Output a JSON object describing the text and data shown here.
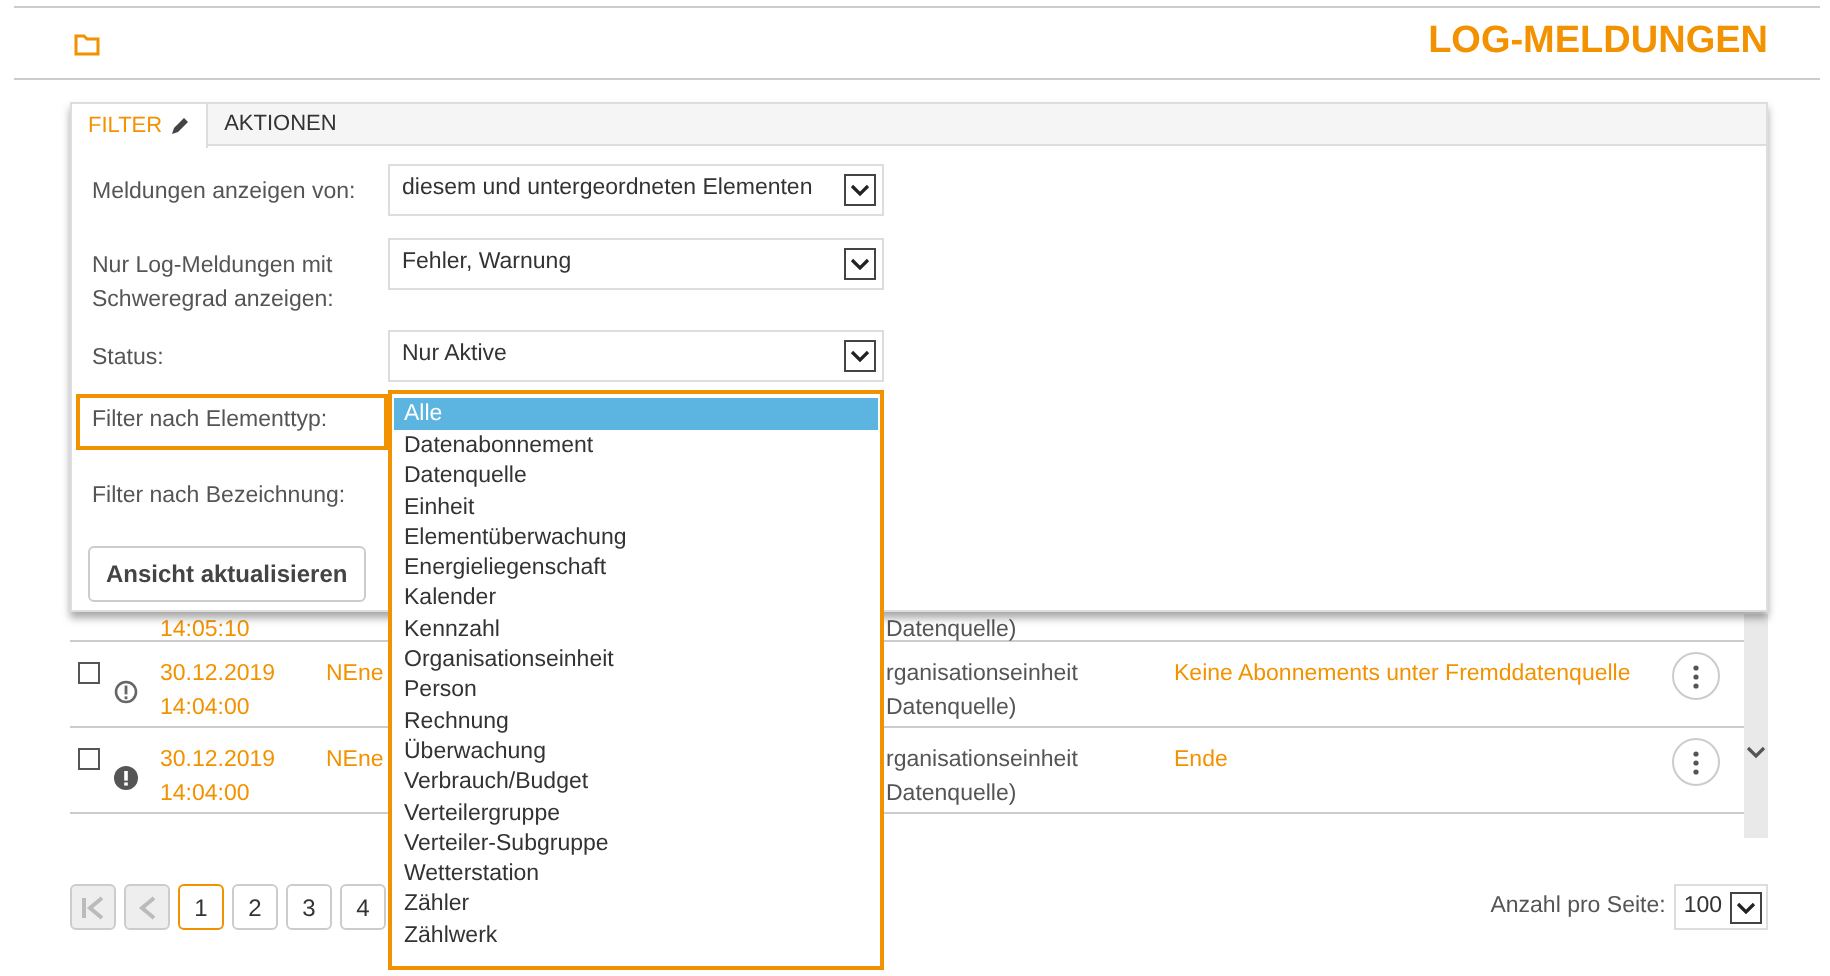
{
  "header": {
    "title": "LOG-MELDUNGEN"
  },
  "filter_panel": {
    "tabs": [
      {
        "label": "FILTER",
        "selected": true
      },
      {
        "label": "AKTIONEN",
        "selected": false
      }
    ],
    "fields": [
      {
        "label": "Meldungen anzeigen von:",
        "value": "diesem und untergeordneten Elementen",
        "focused": false
      },
      {
        "label": "Nur Log-Meldungen mit Schweregrad anzeigen:",
        "value": "Fehler, Warnung",
        "focused": false
      },
      {
        "label": "Status:",
        "value": "Nur Aktive",
        "focused": false
      },
      {
        "label": "Filter nach Elementtyp:",
        "focused": true
      },
      {
        "label": "Filter nach Bezeichnung:",
        "focused": false
      }
    ],
    "button": "Ansicht aktualisieren"
  },
  "dropdown": {
    "options": [
      {
        "label": "Alle",
        "selected": true
      },
      {
        "label": "Datenabonnement",
        "selected": false
      },
      {
        "label": "Datenquelle",
        "selected": false
      },
      {
        "label": "Einheit",
        "selected": false
      },
      {
        "label": "Elementüberwachung",
        "selected": false
      },
      {
        "label": "Energieliegenschaft",
        "selected": false
      },
      {
        "label": "Kalender",
        "selected": false
      },
      {
        "label": "Kennzahl",
        "selected": false
      },
      {
        "label": "Organisationseinheit",
        "selected": false
      },
      {
        "label": "Person",
        "selected": false
      },
      {
        "label": "Rechnung",
        "selected": false
      },
      {
        "label": "Überwachung",
        "selected": false
      },
      {
        "label": "Verbrauch/Budget",
        "selected": false
      },
      {
        "label": "Verteilergruppe",
        "selected": false
      },
      {
        "label": "Verteiler-Subgruppe",
        "selected": false
      },
      {
        "label": "Wetterstation",
        "selected": false
      },
      {
        "label": "Zähler",
        "selected": false
      },
      {
        "label": "Zählwerk",
        "selected": false
      }
    ]
  },
  "table": {
    "rows": [
      {
        "kind": "partial",
        "time": "14:05:10",
        "type_line2": "Datenquelle)"
      },
      {
        "kind": "warning",
        "checked": false,
        "date": "30.12.2019",
        "time": "14:04:00",
        "name": "NEne",
        "type_line1": "rganisationseinheit",
        "type_line2": "Datenquelle)",
        "message": "Keine Abonnements unter Fremddatenquelle"
      },
      {
        "kind": "error",
        "checked": false,
        "date": "30.12.2019",
        "time": "14:04:00",
        "name": "NEne",
        "type_line1": "rganisationseinheit",
        "type_line2": "Datenquelle)",
        "message": "Ende"
      }
    ]
  },
  "pagination": {
    "pages": [
      {
        "label": "1",
        "selected": true
      },
      {
        "label": "2",
        "selected": false
      },
      {
        "label": "3",
        "selected": false
      },
      {
        "label": "4",
        "selected": false
      }
    ],
    "per_page_label": "Anzahl pro Seite:",
    "per_page": "100"
  }
}
